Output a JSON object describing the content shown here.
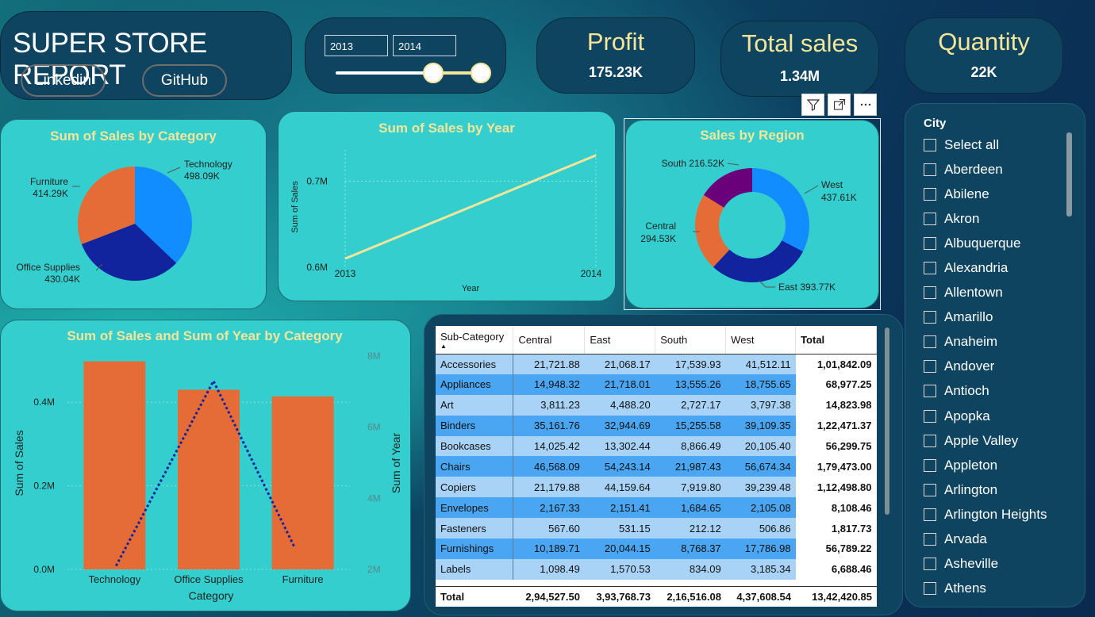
{
  "header": {
    "title": "SUPER STORE REPORT",
    "links": [
      "Linkedin",
      "GitHub"
    ]
  },
  "year_slicer": {
    "from": "2013",
    "to": "2014"
  },
  "kpis": [
    {
      "title": "Profit",
      "value": "175.23K"
    },
    {
      "title": "Total sales",
      "value": "1.34M"
    },
    {
      "title": "Quantity",
      "value": "22K"
    }
  ],
  "visual_toolbar": {
    "icons": [
      "filter-icon",
      "focus-mode-icon",
      "more-options-icon"
    ]
  },
  "category_pie": {
    "title": "Sum of Sales by Category",
    "chart_data": {
      "type": "pie",
      "title": "Sum of Sales by Category",
      "labels": [
        "Technology",
        "Office Supplies",
        "Furniture"
      ],
      "values": [
        498.09,
        430.04,
        414.29
      ],
      "value_labels": [
        "498.09K",
        "430.04K",
        "414.29K"
      ],
      "colors": [
        "#118dff",
        "#12239e",
        "#e66c37"
      ]
    }
  },
  "year_line": {
    "title": "Sum of Sales by Year",
    "chart_data": {
      "type": "line",
      "title": "Sum of Sales by Year",
      "x": [
        "2013",
        "2014"
      ],
      "values": [
        0.61,
        0.73
      ],
      "xlabel": "Year",
      "ylabel": "Sum of Sales",
      "yticks": [
        "0.6M",
        "0.7M"
      ],
      "ylim": [
        0.6,
        0.74
      ],
      "color": "#f3e59a"
    }
  },
  "region_donut": {
    "title": "Sales by Region",
    "chart_data": {
      "type": "pie",
      "title": "Sales by Region",
      "labels": [
        "West",
        "East",
        "Central",
        "South"
      ],
      "values": [
        437.61,
        393.77,
        294.53,
        216.52
      ],
      "label_texts": [
        "West",
        "East 393.77K",
        "Central",
        "South 216.52K"
      ],
      "value_texts": [
        "437.61K",
        "",
        "294.53K",
        ""
      ],
      "colors": [
        "#118dff",
        "#12239e",
        "#e66c37",
        "#6b007b"
      ]
    }
  },
  "combo_chart": {
    "title": "Sum of Sales and Sum of Year by Category",
    "chart_data": {
      "type": "bar",
      "title": "Sum of Sales and Sum of Year by Category",
      "categories": [
        "Technology",
        "Office Supplies",
        "Furniture"
      ],
      "series": [
        {
          "name": "Sum of Sales",
          "values": [
            0.498,
            0.43,
            0.414
          ]
        },
        {
          "name": "Sum of Year",
          "values": [
            2.1,
            7.3,
            2.6
          ]
        }
      ],
      "xlabel": "Category",
      "ylabel": "Sum of Sales",
      "y2label": "Sum of Year",
      "yticks": [
        "0.0M",
        "0.2M",
        "0.4M"
      ],
      "y2ticks": [
        "2M",
        "4M",
        "6M",
        "8M"
      ],
      "ylim": [
        0,
        0.52
      ],
      "y2lim": [
        2,
        8
      ],
      "bar_color": "#e66c37",
      "line_color": "#12239e"
    }
  },
  "matrix": {
    "columns": [
      "Sub-Category",
      "Central",
      "East",
      "South",
      "West",
      "Total"
    ],
    "rows": [
      [
        "Accessories",
        "21,721.88",
        "21,068.17",
        "17,539.93",
        "41,512.11",
        "1,01,842.09"
      ],
      [
        "Appliances",
        "14,948.32",
        "21,718.01",
        "13,555.26",
        "18,755.65",
        "68,977.25"
      ],
      [
        "Art",
        "3,811.23",
        "4,488.20",
        "2,727.17",
        "3,797.38",
        "14,823.98"
      ],
      [
        "Binders",
        "35,161.76",
        "32,944.69",
        "15,255.58",
        "39,109.35",
        "1,22,471.37"
      ],
      [
        "Bookcases",
        "14,025.42",
        "13,302.44",
        "8,866.49",
        "20,105.40",
        "56,299.75"
      ],
      [
        "Chairs",
        "46,568.09",
        "54,243.14",
        "21,987.43",
        "56,674.34",
        "1,79,473.00"
      ],
      [
        "Copiers",
        "21,179.88",
        "44,159.64",
        "7,919.80",
        "39,239.48",
        "1,12,498.80"
      ],
      [
        "Envelopes",
        "2,167.33",
        "2,151.41",
        "1,684.65",
        "2,105.08",
        "8,108.46"
      ],
      [
        "Fasteners",
        "567.60",
        "531.15",
        "212.12",
        "506.86",
        "1,817.73"
      ],
      [
        "Furnishings",
        "10,189.71",
        "20,044.15",
        "8,768.37",
        "17,786.98",
        "56,789.22"
      ],
      [
        "Labels",
        "1,098.49",
        "1,570.53",
        "834.09",
        "3,185.34",
        "6,688.46"
      ]
    ],
    "total_row": [
      "Total",
      "2,94,527.50",
      "3,93,768.73",
      "2,16,516.08",
      "4,37,608.54",
      "13,42,420.85"
    ]
  },
  "city_slicer": {
    "title": "City",
    "items": [
      "Select all",
      "Aberdeen",
      "Abilene",
      "Akron",
      "Albuquerque",
      "Alexandria",
      "Allentown",
      "Amarillo",
      "Anaheim",
      "Andover",
      "Antioch",
      "Apopka",
      "Apple Valley",
      "Appleton",
      "Arlington",
      "Arlington Heights",
      "Arvada",
      "Asheville",
      "Athens"
    ]
  }
}
